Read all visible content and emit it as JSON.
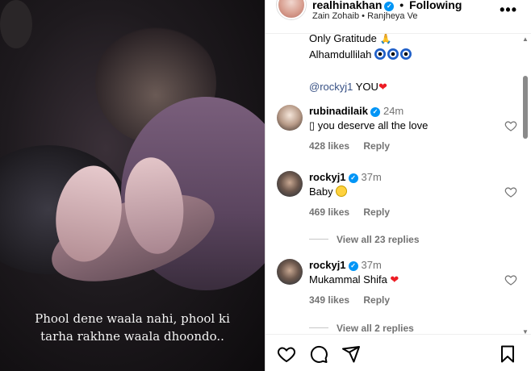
{
  "media": {
    "caption_line1": "Phool dene waala nahi, phool ki",
    "caption_line2": "tarha rakhne waala dhoondo.."
  },
  "header": {
    "username": "realhinakhan",
    "verified_mark": "✓",
    "separator": "•",
    "follow_status": "Following",
    "audio_artist": "Zain Zohaib",
    "audio_separator": "•",
    "audio_track": "Ranjheya Ve",
    "more_icon": "more-horizontal-icon"
  },
  "post_caption": {
    "line1": "Only Gratitude",
    "line1_emoji": "🙏",
    "line2": "Alhamdullilah",
    "line3_mention": "@rockyj1",
    "line3_text": " YOU",
    "line3_emoji": "❤"
  },
  "comments": [
    {
      "username": "rubinadilaik",
      "time": "24m",
      "text_prefix": "▯",
      "text": " you deserve all the love",
      "likes": "428 likes",
      "reply": "Reply"
    },
    {
      "username": "rockyj1",
      "time": "37m",
      "text": "Baby ",
      "likes": "469 likes",
      "reply": "Reply",
      "view_replies": "View all 23 replies"
    },
    {
      "username": "rockyj1",
      "time": "37m",
      "text": "Mukammal Shifa ",
      "text_emoji": "❤",
      "likes": "349 likes",
      "reply": "Reply",
      "view_replies": "View all 2 replies"
    }
  ],
  "scrollbar": {
    "up": "▲",
    "down": "▼"
  },
  "actions": {
    "like_icon": "heart-icon",
    "comment_icon": "comment-icon",
    "share_icon": "send-icon",
    "save_icon": "bookmark-icon"
  },
  "colors": {
    "verified": "#0095f6",
    "mention": "#385185",
    "heart": "#ed1c24",
    "muted": "#737373"
  }
}
